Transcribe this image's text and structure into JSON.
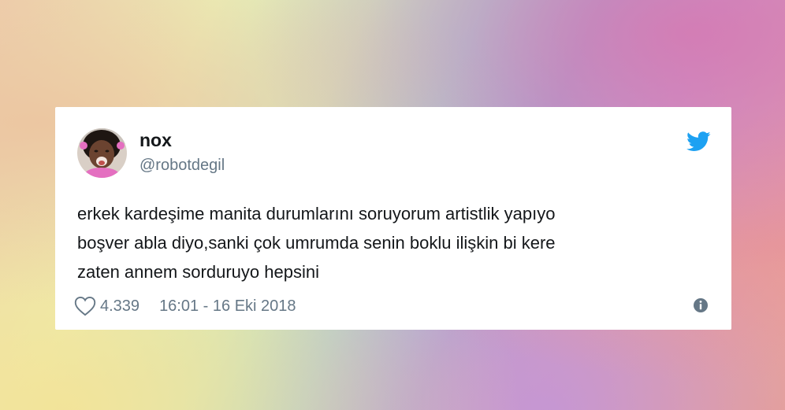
{
  "tweet": {
    "display_name": "nox",
    "handle": "@robotdegil",
    "text_lines": [
      "erkek kardeşime manita durumlarını soruyorum artistlik yapıyo",
      "boşver abla diyo,sanki çok umrumda senin boklu ilişkin bi kere",
      "zaten annem sorduruyo hepsini"
    ],
    "likes": "4.339",
    "timestamp": "16:01 - 16 Eki 2018"
  },
  "icons": {
    "brand": "twitter-bird-icon",
    "like": "heart-icon",
    "info": "info-icon"
  },
  "colors": {
    "twitter_blue": "#1da1f2",
    "text": "#14171a",
    "muted": "#657786"
  }
}
